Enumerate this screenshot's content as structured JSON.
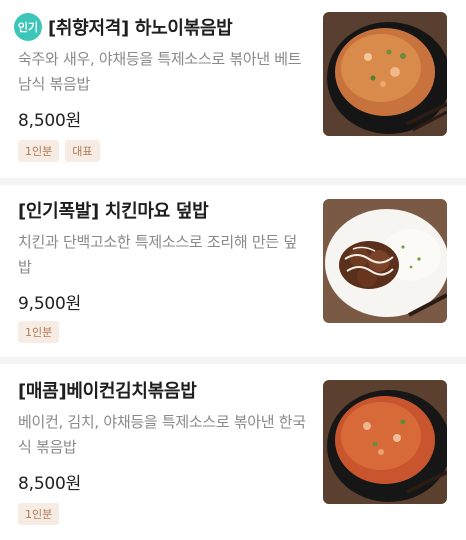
{
  "menu": {
    "items": [
      {
        "popular_badge": "인기",
        "title": "[취향저격] 하노이볶음밥",
        "description": "숙주와 새우, 야채등을 특제소스로 볶아낸 베트남식 볶음밥",
        "price": "8,500원",
        "tags": [
          "1인분",
          "대표"
        ],
        "image": "hanoi-fried-rice-photo"
      },
      {
        "title": "[인기폭발] 치킨마요 덮밥",
        "description": "치킨과 단백고소한 특제소스로 조리해 만든 덮밥",
        "price": "9,500원",
        "tags": [
          "1인분"
        ],
        "image": "chicken-mayo-rice-bowl-photo"
      },
      {
        "title": "[매콤]베이컨김치볶음밥",
        "description": "베이컨, 김치, 야채등을 특제소스로 볶아낸 한국식 볶음밥",
        "price": "8,500원",
        "tags": [
          "1인분"
        ],
        "image": "bacon-kimchi-fried-rice-photo"
      }
    ]
  }
}
